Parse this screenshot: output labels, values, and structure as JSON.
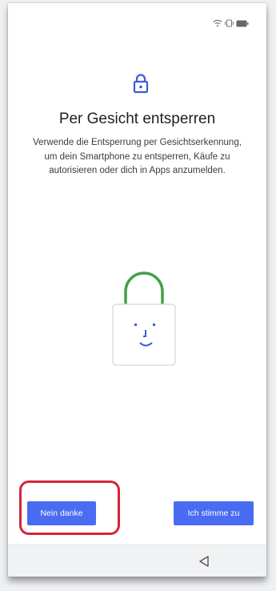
{
  "status_bar": {
    "icons": [
      "wifi-icon",
      "vibrate-icon",
      "battery-icon"
    ]
  },
  "header": {
    "icon": "lock-icon",
    "title": "Per Gesicht entsperren",
    "description": "Verwende die Entsperrung per Gesichtserkennung, um dein Smartphone zu entsperren, Käufe zu autorisieren oder dich in Apps anzumelden."
  },
  "illustration": {
    "icon": "face-unlock-illustration"
  },
  "footer": {
    "decline_label": "Nein danke",
    "accept_label": "Ich stimme zu"
  },
  "nav_bar": {
    "back_icon": "back-icon"
  },
  "colors": {
    "accent": "#4a6cf2",
    "shackle": "#43a047",
    "highlight": "#d32638"
  }
}
